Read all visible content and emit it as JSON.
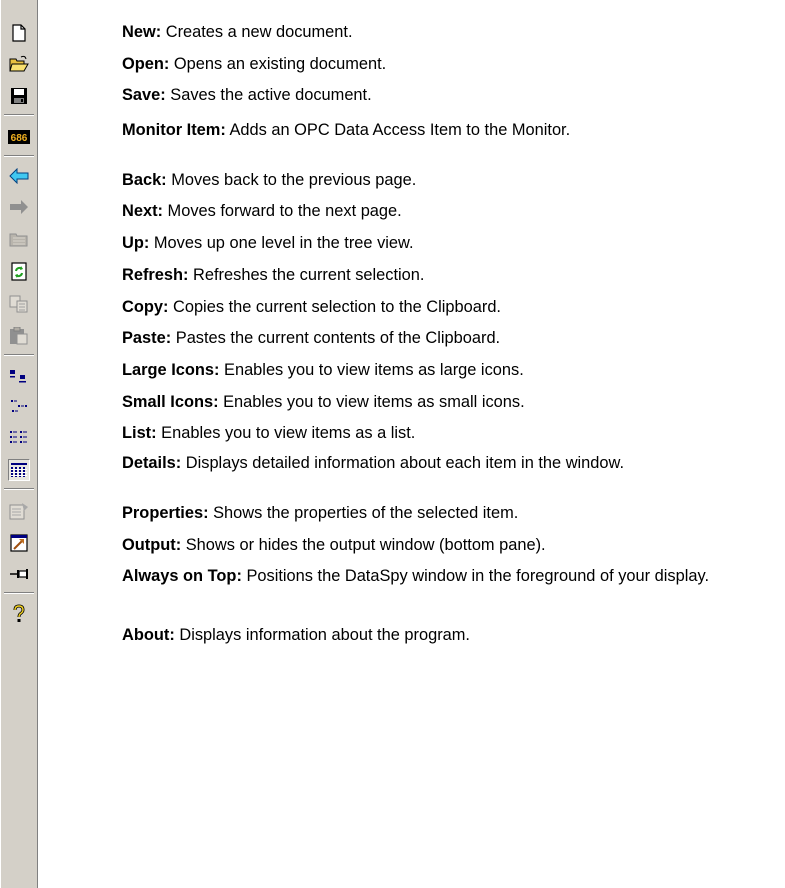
{
  "toolbar": {
    "buttons": [
      {
        "icon": "new-document-icon",
        "enabled": true
      },
      {
        "icon": "open-folder-icon",
        "enabled": true
      },
      {
        "icon": "save-disk-icon",
        "enabled": true
      },
      {
        "icon": "monitor-item-icon",
        "enabled": true
      },
      {
        "icon": "back-arrow-icon",
        "enabled": true
      },
      {
        "icon": "next-arrow-icon",
        "enabled": false
      },
      {
        "icon": "up-folder-icon",
        "enabled": false
      },
      {
        "icon": "refresh-icon",
        "enabled": true
      },
      {
        "icon": "copy-icon",
        "enabled": false
      },
      {
        "icon": "paste-icon",
        "enabled": false
      },
      {
        "icon": "large-icons-view-icon",
        "enabled": true
      },
      {
        "icon": "small-icons-view-icon",
        "enabled": true
      },
      {
        "icon": "list-view-icon",
        "enabled": true
      },
      {
        "icon": "details-view-icon",
        "enabled": true,
        "pressed": true
      },
      {
        "icon": "properties-icon",
        "enabled": false
      },
      {
        "icon": "output-window-icon",
        "enabled": true
      },
      {
        "icon": "always-on-top-pin-icon",
        "enabled": true
      },
      {
        "icon": "about-help-icon",
        "enabled": true
      }
    ]
  },
  "items": [
    {
      "term": "New:",
      "text": " Creates a new document."
    },
    {
      "term": "Open:",
      "text": " Opens an existing document."
    },
    {
      "term": "Save:",
      "text": " Saves the active document."
    },
    {
      "term": "Monitor Item:",
      "text": " Adds an OPC Data Access Item to the Monitor."
    },
    {
      "term": "Back:",
      "text": " Moves back to the previous page."
    },
    {
      "term": "Next:",
      "text": " Moves forward to the next page."
    },
    {
      "term": "Up:",
      "text": " Moves up one level in the tree view."
    },
    {
      "term": "Refresh:",
      "text": " Refreshes the current selection."
    },
    {
      "term": "Copy:",
      "text": " Copies the current selection to the Clipboard."
    },
    {
      "term": "Paste:",
      "text": " Pastes the current contents of the Clipboard."
    },
    {
      "term": "Large Icons:",
      "text": " Enables you to view items as large icons."
    },
    {
      "term": "Small Icons:",
      "text": " Enables you to view items as small icons."
    },
    {
      "term": "List:",
      "text": " Enables you to view items as a list."
    },
    {
      "term": "Details:",
      "text": " Displays detailed information about each item in the window."
    },
    {
      "term": "Properties:",
      "text": " Shows the properties of the selected item."
    },
    {
      "term": "Output:",
      "text": " Shows or hides the output window (bottom pane)."
    },
    {
      "term": "Always on Top:",
      "text": " Positions the DataSpy window in the foreground of your display."
    },
    {
      "term": "About:",
      "text": " Displays information about the program."
    }
  ]
}
